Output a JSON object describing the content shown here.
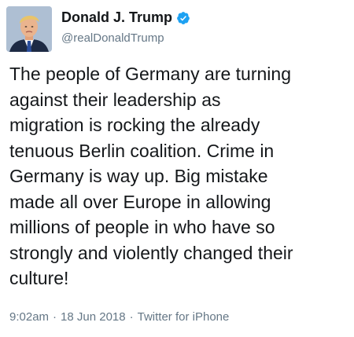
{
  "author": {
    "display_name": "Donald J. Trump",
    "handle": "@realDonaldTrump",
    "verified": true,
    "avatar_icon": "profile-photo"
  },
  "tweet": {
    "text": "The people of Germany are turning\nagainst their leadership as\nmigration is rocking the already\ntenuous Berlin coalition. Crime in\nGermany is way up. Big mistake\nmade all over Europe in allowing\nmillions of people in who have so\nstrongly and violently changed their\nculture!"
  },
  "meta": {
    "time": "9:02am",
    "separator": "·",
    "date": "18 Jun 2018",
    "source": "Twitter for iPhone"
  },
  "colors": {
    "verified": "#1da1f2",
    "secondary_text": "#657786",
    "primary_text": "#14171a"
  }
}
